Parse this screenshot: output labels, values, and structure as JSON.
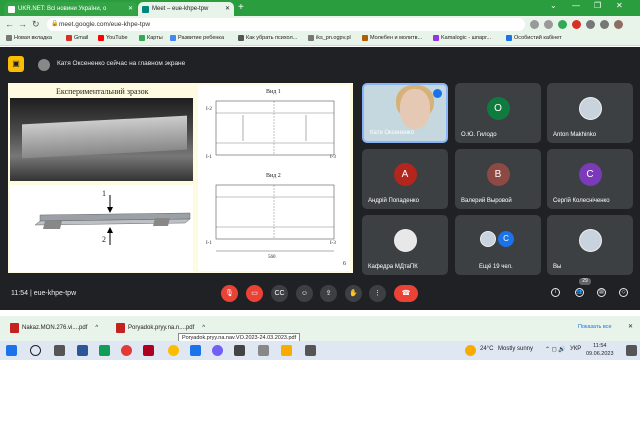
{
  "browser": {
    "tabs": [
      {
        "title": "UKR.NET: Всі новини України, о",
        "favicon_color": "#ffffff"
      },
      {
        "title": "Meet – eue-khpe-tpw",
        "favicon_color": "#00897b"
      }
    ],
    "url": "meet.google.com/eue-khpe-tpw",
    "bookmarks": [
      {
        "label": "Новая вкладка",
        "color": "#777777"
      },
      {
        "label": "Gmail",
        "color": "#d93025"
      },
      {
        "label": "YouTube",
        "color": "#ff0000"
      },
      {
        "label": "Карты",
        "color": "#34a853"
      },
      {
        "label": "Развитие ребенка",
        "color": "#4285f4"
      },
      {
        "label": "Как убрать психол...",
        "color": "#555555"
      },
      {
        "label": "iks_pn.ogpv.pl",
        "color": "#777777"
      },
      {
        "label": "Молебен и молитв...",
        "color": "#b06000"
      },
      {
        "label": "Kamalogic - шпарг...",
        "color": "#9334e6"
      },
      {
        "label": "Особистий кабінет",
        "color": "#1a73e8"
      }
    ]
  },
  "meet": {
    "presenting_text": "Катя Оксененко сейчас на главном экране",
    "slide": {
      "title": "Експериментальний зразок",
      "arrow_label_1": "1",
      "arrow_label_2": "2",
      "view1": "Вид 1",
      "view2": "Вид 2",
      "section_labels": [
        "I-2",
        "I-1",
        "I-3",
        "I-1",
        "I-3"
      ],
      "dimension": "560",
      "page_number": "6"
    },
    "participants": [
      {
        "name": "Катя Оксененко",
        "initial": "",
        "color": "#c5d8e0",
        "active": true
      },
      {
        "name": "О.Ю. Гилодо",
        "initial": "О",
        "color": "#0f7b3f"
      },
      {
        "name": "Anton Makhinko",
        "initial": "",
        "color": "#c9d3dd"
      },
      {
        "name": "Андрій Попаденко",
        "initial": "А",
        "color": "#b3261e"
      },
      {
        "name": "Валерий Выровой",
        "initial": "В",
        "color": "#8c4a42"
      },
      {
        "name": "Сергій Колесніченко",
        "initial": "С",
        "color": "#7b3ab7"
      },
      {
        "name": "Кафедра МДтаПК",
        "initial": "",
        "color": "#e8e8e8"
      },
      {
        "name": "Ещё 19 чел.",
        "initial": "С",
        "color": "#1a73e8"
      },
      {
        "name": "Вы",
        "initial": "",
        "color": "#c9d3dd"
      }
    ],
    "time": "11:54",
    "meeting_code": "eue-khpe-tpw",
    "participant_count": "29",
    "controls": [
      "mic-off",
      "camera-off",
      "captions",
      "emoji",
      "present",
      "raise-hand",
      "more",
      "leave-call"
    ]
  },
  "downloads": {
    "items": [
      "Nakaz.MON.276.vi....pdf",
      "Poryadok.pryy.na.n....pdf"
    ],
    "tooltip": "Poryadok.pryy.na.nav.VO.2023-24.03.2023.pdf",
    "show_all": "Показать все"
  },
  "taskbar": {
    "weather": "24°C",
    "weather_text": "Mostly sunny",
    "language": "УКР",
    "time": "11:54",
    "date": "09.06.2023"
  }
}
